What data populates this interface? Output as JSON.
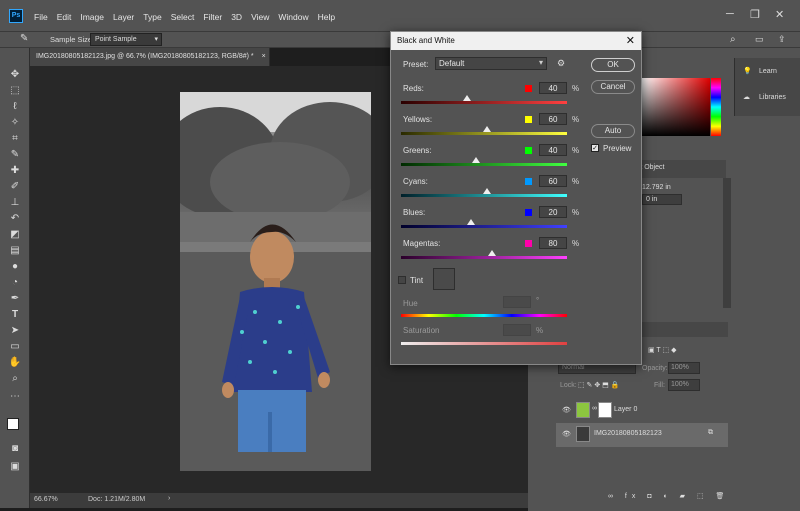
{
  "menubar": {
    "app_badge": "Ps",
    "items": [
      "File",
      "Edit",
      "Image",
      "Layer",
      "Type",
      "Select",
      "Filter",
      "3D",
      "View",
      "Window",
      "Help"
    ]
  },
  "options": {
    "sample_size_label": "Sample Size:",
    "sample_size_value": "Point Sample"
  },
  "document": {
    "tab_title": "IMG20180805182123.jpg @ 66.7% (IMG20180805182123, RGB/8#) *",
    "zoom": "66.67%",
    "doc_info": "Doc: 1.21M/2.80M"
  },
  "right_panel": {
    "learn": "Learn",
    "libraries": "Libraries",
    "smart_object": "rt Object",
    "width_value": "12.792 in",
    "y_value": "0 in",
    "blend_mode": "Normal",
    "opacity_label": "Opacity:",
    "opacity_value": "100%",
    "lock_label": "Lock:",
    "fill_label": "Fill:",
    "fill_value": "100%",
    "layers": [
      {
        "name": "Layer 0"
      },
      {
        "name": "IMG20180805182123"
      }
    ]
  },
  "dialog": {
    "title": "Black and White",
    "preset_label": "Preset:",
    "preset_value": "Default",
    "ok": "OK",
    "cancel": "Cancel",
    "auto": "Auto",
    "preview": "Preview",
    "preview_checked": true,
    "tint_label": "Tint",
    "hue_label": "Hue",
    "hue_unit": "°",
    "saturation_label": "Saturation",
    "saturation_unit": "%",
    "pct": "%",
    "sliders": [
      {
        "name": "Reds:",
        "value": "40",
        "color": "#ff0000",
        "fraction": 0.4,
        "track": "linear-gradient(90deg,#2a0000,#ff4040)"
      },
      {
        "name": "Yellows:",
        "value": "60",
        "color": "#ffff00",
        "fraction": 0.52,
        "track": "linear-gradient(90deg,#2a2a00,#ffff40)"
      },
      {
        "name": "Greens:",
        "value": "40",
        "color": "#00ff00",
        "fraction": 0.45,
        "track": "linear-gradient(90deg,#002a00,#40ff40)"
      },
      {
        "name": "Cyans:",
        "value": "60",
        "color": "#0099ff",
        "fraction": 0.52,
        "track": "linear-gradient(90deg,#00202a,#40ffff)"
      },
      {
        "name": "Blues:",
        "value": "20",
        "color": "#0000ff",
        "fraction": 0.42,
        "track": "linear-gradient(90deg,#00002a,#4040ff)"
      },
      {
        "name": "Magentas:",
        "value": "80",
        "color": "#ff00aa",
        "fraction": 0.55,
        "track": "linear-gradient(90deg,#2a002a,#ff40ff)"
      }
    ]
  }
}
